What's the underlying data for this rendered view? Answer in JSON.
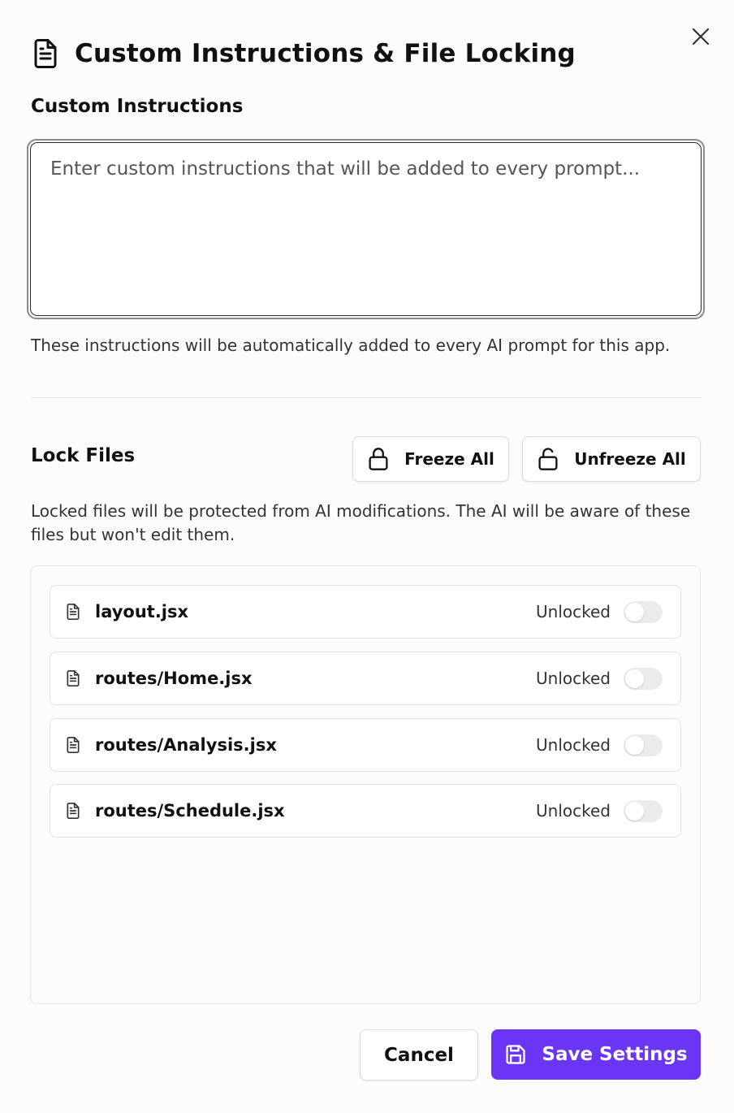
{
  "dialog": {
    "title": "Custom Instructions & File Locking",
    "title_icon": "file-text-icon",
    "close_icon": "close-icon"
  },
  "instructions": {
    "label": "Custom Instructions",
    "placeholder": "Enter custom instructions that will be added to every prompt...",
    "value": "",
    "help": "These instructions will be automatically added to every AI prompt for this app."
  },
  "lock": {
    "title": "Lock Files",
    "freeze_all": "Freeze All",
    "unfreeze_all": "Unfreeze All",
    "freeze_icon": "lock-icon",
    "unfreeze_icon": "unlock-icon",
    "description": "Locked files will be protected from AI modifications. The AI will be aware of these files but won't edit them.",
    "files": [
      {
        "name": "layout.jsx",
        "status": "Unlocked",
        "locked": false
      },
      {
        "name": "routes/Home.jsx",
        "status": "Unlocked",
        "locked": false
      },
      {
        "name": "routes/Analysis.jsx",
        "status": "Unlocked",
        "locked": false
      },
      {
        "name": "routes/Schedule.jsx",
        "status": "Unlocked",
        "locked": false
      }
    ]
  },
  "footer": {
    "cancel": "Cancel",
    "save": "Save Settings",
    "save_icon": "save-icon"
  },
  "colors": {
    "accent": "#6b35f5",
    "toggle_off": "#ebebeb"
  }
}
